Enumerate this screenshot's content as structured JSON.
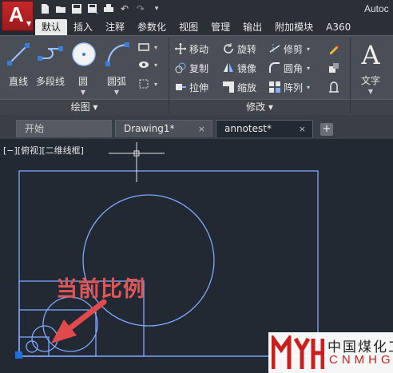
{
  "app": {
    "logo_letter": "A",
    "title": "Autoc",
    "quick_access": [
      "new-icon",
      "open-icon",
      "save-icon",
      "save-as-icon",
      "print-icon",
      "undo-icon",
      "redo-icon",
      "customize-icon"
    ]
  },
  "ribbon_tabs": [
    "默认",
    "插入",
    "注释",
    "参数化",
    "视图",
    "管理",
    "输出",
    "附加模块",
    "A360"
  ],
  "ribbon": {
    "draw_panel": {
      "title": "绘图 ▾",
      "tools": [
        "直线",
        "多段线",
        "圆",
        "圆弧"
      ]
    },
    "modify_panel": {
      "title": "修改 ▾",
      "col1": [
        "移动",
        "复制",
        "拉伸"
      ],
      "col2": [
        "旋转",
        "镜像",
        "缩放"
      ],
      "col3": [
        "修剪",
        "圆角",
        "阵列"
      ]
    },
    "annotation_panel": {
      "text_label": "文字",
      "text_glyph": "A"
    }
  },
  "file_tabs": {
    "home": "开始",
    "items": [
      {
        "label": "Drawing1*"
      },
      {
        "label": "annotest*"
      }
    ],
    "close_glyph": "×",
    "add_glyph": "+"
  },
  "canvas": {
    "view_label": "[−][俯视][二维线框]",
    "annotation": "当前比例"
  },
  "colors": {
    "drawing_line": "#7fa8ff",
    "canvas_bg": "#222933",
    "annotation_red": "#e05556",
    "accent_red": "#c8262a"
  },
  "watermark": {
    "cn": "中国煤化工",
    "en": "CNMHG"
  }
}
